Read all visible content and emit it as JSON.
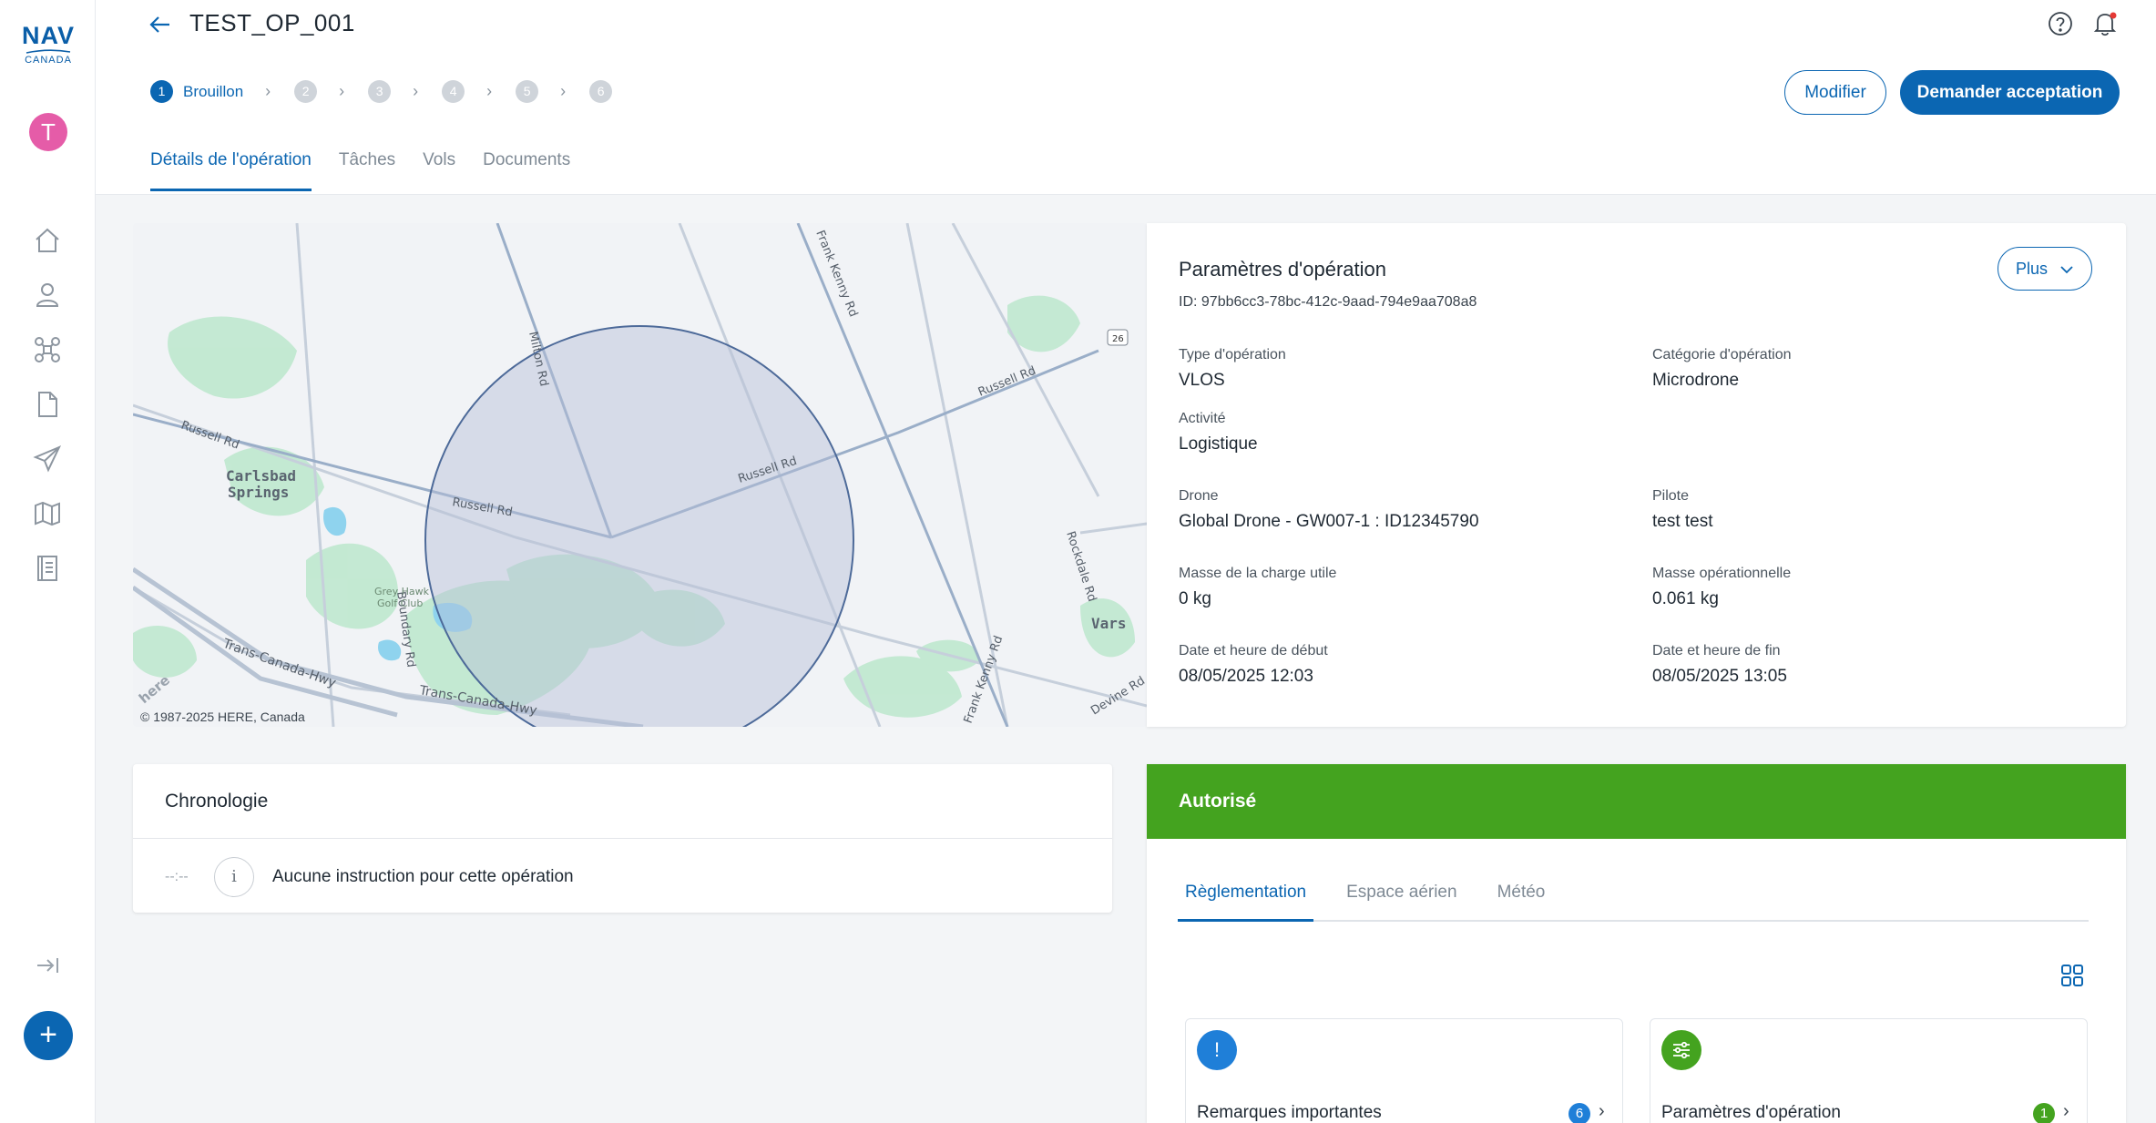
{
  "brand": {
    "name": "NAV",
    "sub": "CANADA"
  },
  "user": {
    "initial": "T"
  },
  "sidebar": {
    "items": [
      {
        "name": "home-icon"
      },
      {
        "name": "user-icon"
      },
      {
        "name": "drone-icon"
      },
      {
        "name": "document-icon"
      },
      {
        "name": "send-icon"
      },
      {
        "name": "map-icon"
      },
      {
        "name": "logbook-icon"
      }
    ],
    "collapse_icon": "collapse-right-icon",
    "fab_label": "+"
  },
  "header": {
    "title": "TEST_OP_001",
    "steps": [
      "1",
      "2",
      "3",
      "4",
      "5",
      "6"
    ],
    "active_step_label": "Brouillon",
    "modify_label": "Modifier",
    "request_label": "Demander acceptation",
    "tabs": [
      "Détails de l'opération",
      "Tâches",
      "Vols",
      "Documents"
    ]
  },
  "map": {
    "labels": {
      "milton": "Milton Rd",
      "frank_kenny_top": "Frank Kenny Rd",
      "frank_kenny_bottom": "Frank Kenny Rd",
      "russell_left": "Russell Rd",
      "russell_mid": "Russell Rd",
      "russell_center": "Russell Rd",
      "russell_right": "Russell Rd",
      "carlsbad_1": "Carlsbad",
      "carlsbad_2": "Springs",
      "grey_hawk_1": "Grey Hawk",
      "grey_hawk_2": "Golf Club",
      "boundary": "Boundary Rd",
      "tch_1": "Trans-Canada-Hwy",
      "tch_2": "Trans-Canada-Hwy",
      "rockdale": "Rockdale Rd",
      "vars": "Vars",
      "devine": "Devine Rd",
      "hwy": "26",
      "here": "here",
      "copyright": "© 1987-2025 HERE, Canada"
    }
  },
  "params": {
    "title": "Paramètres d'opération",
    "id": "ID: 97bb6cc3-78bc-412c-9aad-794e9aa708a8",
    "more_label": "Plus",
    "type_label": "Type d'opération",
    "type_value": "VLOS",
    "category_label": "Catégorie d'opération",
    "category_value": "Microdrone",
    "activity_label": "Activité",
    "activity_value": "Logistique",
    "drone_label": "Drone",
    "drone_value": "Global Drone - GW007-1 : ID12345790",
    "pilot_label": "Pilote",
    "pilot_value": "test test",
    "payload_label": "Masse de la charge utile",
    "payload_value": "0 kg",
    "mass_label": "Masse opérationnelle",
    "mass_value": "0.061 kg",
    "start_label": "Date et heure de début",
    "start_value": "08/05/2025 12:03",
    "end_label": "Date et heure de fin",
    "end_value": "08/05/2025 13:05"
  },
  "chronology": {
    "title": "Chronologie",
    "time": "--:--",
    "info": "i",
    "message": "Aucune instruction pour cette opération"
  },
  "authorization": {
    "status": "Autorisé",
    "status_color": "#44a31f",
    "tabs": [
      "Règlementation",
      "Espace aérien",
      "Météo"
    ],
    "cards": [
      {
        "label": "Remarques importantes",
        "count": "6",
        "icon": "!",
        "color": "#1f7fd8"
      },
      {
        "label": "Paramètres d'opération",
        "count": "1",
        "icon": "sliders-icon",
        "color": "#44a31f"
      }
    ]
  },
  "colors": {
    "accent": "#0b66b2",
    "success": "#44a31f"
  }
}
